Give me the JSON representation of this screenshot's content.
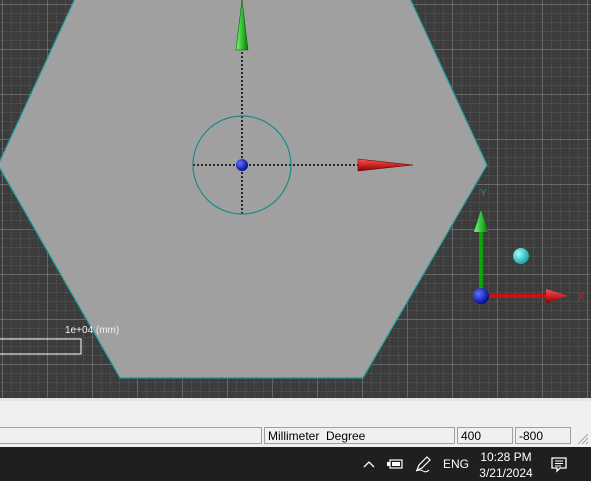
{
  "viewport": {
    "scale_label": "1e+04 (mm)",
    "axis_labels": {
      "x": "X",
      "y": "Y"
    },
    "colors": {
      "background": "#3c3c3c",
      "grid": "#7a7a7a",
      "shape_fill": "#a0a0a0",
      "shape_edge": "#1a9a9a",
      "x_axis": "#cc1010",
      "y_axis": "#10a010",
      "origin": "#1020c0",
      "light": "#20c8c8"
    }
  },
  "status_bar": {
    "units": "Millimeter  Degree",
    "coord_x": "400",
    "coord_y": "-800"
  },
  "taskbar": {
    "language": "ENG",
    "time": "10:28 PM",
    "date": "3/21/2024",
    "icons": [
      "chevron-up-icon",
      "battery-icon",
      "pen-icon",
      "notification-icon"
    ]
  }
}
